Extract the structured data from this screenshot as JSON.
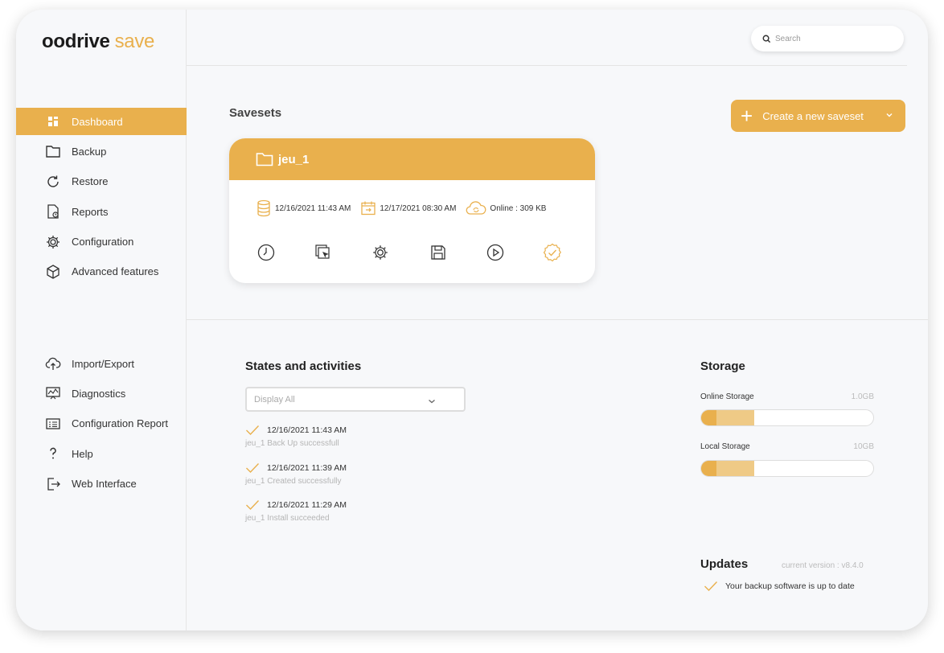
{
  "app": {
    "logo_main": "oodrive",
    "logo_accent": "save",
    "accent_color": "#e9b04d"
  },
  "search": {
    "placeholder": "Search"
  },
  "sidebar": {
    "primary": [
      {
        "label": "Dashboard",
        "icon": "dashboard-icon",
        "active": true
      },
      {
        "label": "Backup",
        "icon": "folder-icon"
      },
      {
        "label": "Restore",
        "icon": "restore-icon"
      },
      {
        "label": "Reports",
        "icon": "report-icon"
      },
      {
        "label": "Configuration",
        "icon": "gear-icon"
      },
      {
        "label": "Advanced features",
        "icon": "cube-icon"
      }
    ],
    "secondary": [
      {
        "label": "Import/Export",
        "icon": "cloud-upload-icon"
      },
      {
        "label": "Diagnostics",
        "icon": "monitor-chart-icon"
      },
      {
        "label": "Configuration Report",
        "icon": "list-report-icon"
      },
      {
        "label": "Help",
        "icon": "question-icon"
      },
      {
        "label": "Web Interface",
        "icon": "exit-icon"
      }
    ]
  },
  "savesets": {
    "heading": "Savesets",
    "create_label": "Create a new saveset",
    "card": {
      "name": "jeu_1",
      "last_backup": "12/16/2021 11:43 AM",
      "next_backup": "12/17/2021 08:30 AM",
      "online_size": "Online : 309 KB",
      "actions": [
        "clock-icon",
        "copy-cursor-icon",
        "gear-icon",
        "save-icon",
        "play-icon",
        "check-badge-icon"
      ]
    }
  },
  "states": {
    "heading": "States and activities",
    "filter_value": "Display All",
    "items": [
      {
        "time": "12/16/2021 11:43 AM",
        "text": "jeu_1 Back Up successfull"
      },
      {
        "time": "12/16/2021 11:39 AM",
        "text": "jeu_1 Created successfully"
      },
      {
        "time": "12/16/2021 11:29 AM",
        "text": "jeu_1 Install succeeded"
      }
    ]
  },
  "storage": {
    "heading": "Storage",
    "online": {
      "label": "Online Storage",
      "capacity": "1.0GB",
      "used_fraction": 0.09,
      "second_fraction": 0.31
    },
    "local": {
      "label": "Local Storage",
      "capacity": "10GB",
      "used_fraction": 0.09,
      "second_fraction": 0.31
    }
  },
  "updates": {
    "heading": "Updates",
    "version": "current version : v8.4.0",
    "status": "Your backup software is up to date"
  }
}
